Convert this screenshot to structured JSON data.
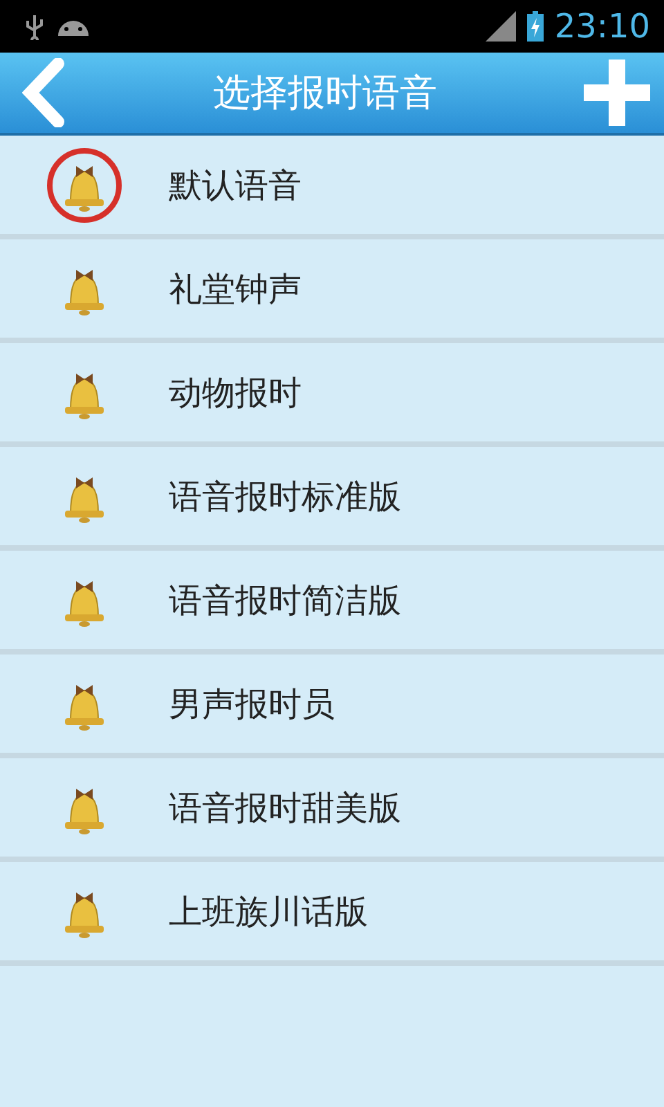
{
  "status_bar": {
    "time": "23:10"
  },
  "header": {
    "title": "选择报时语音"
  },
  "voices": [
    {
      "label": "默认语音",
      "selected": true
    },
    {
      "label": "礼堂钟声",
      "selected": false
    },
    {
      "label": "动物报时",
      "selected": false
    },
    {
      "label": "语音报时标准版",
      "selected": false
    },
    {
      "label": "语音报时简洁版",
      "selected": false
    },
    {
      "label": "男声报时员",
      "selected": false
    },
    {
      "label": "语音报时甜美版",
      "selected": false
    },
    {
      "label": "上班族川话版",
      "selected": false
    }
  ]
}
